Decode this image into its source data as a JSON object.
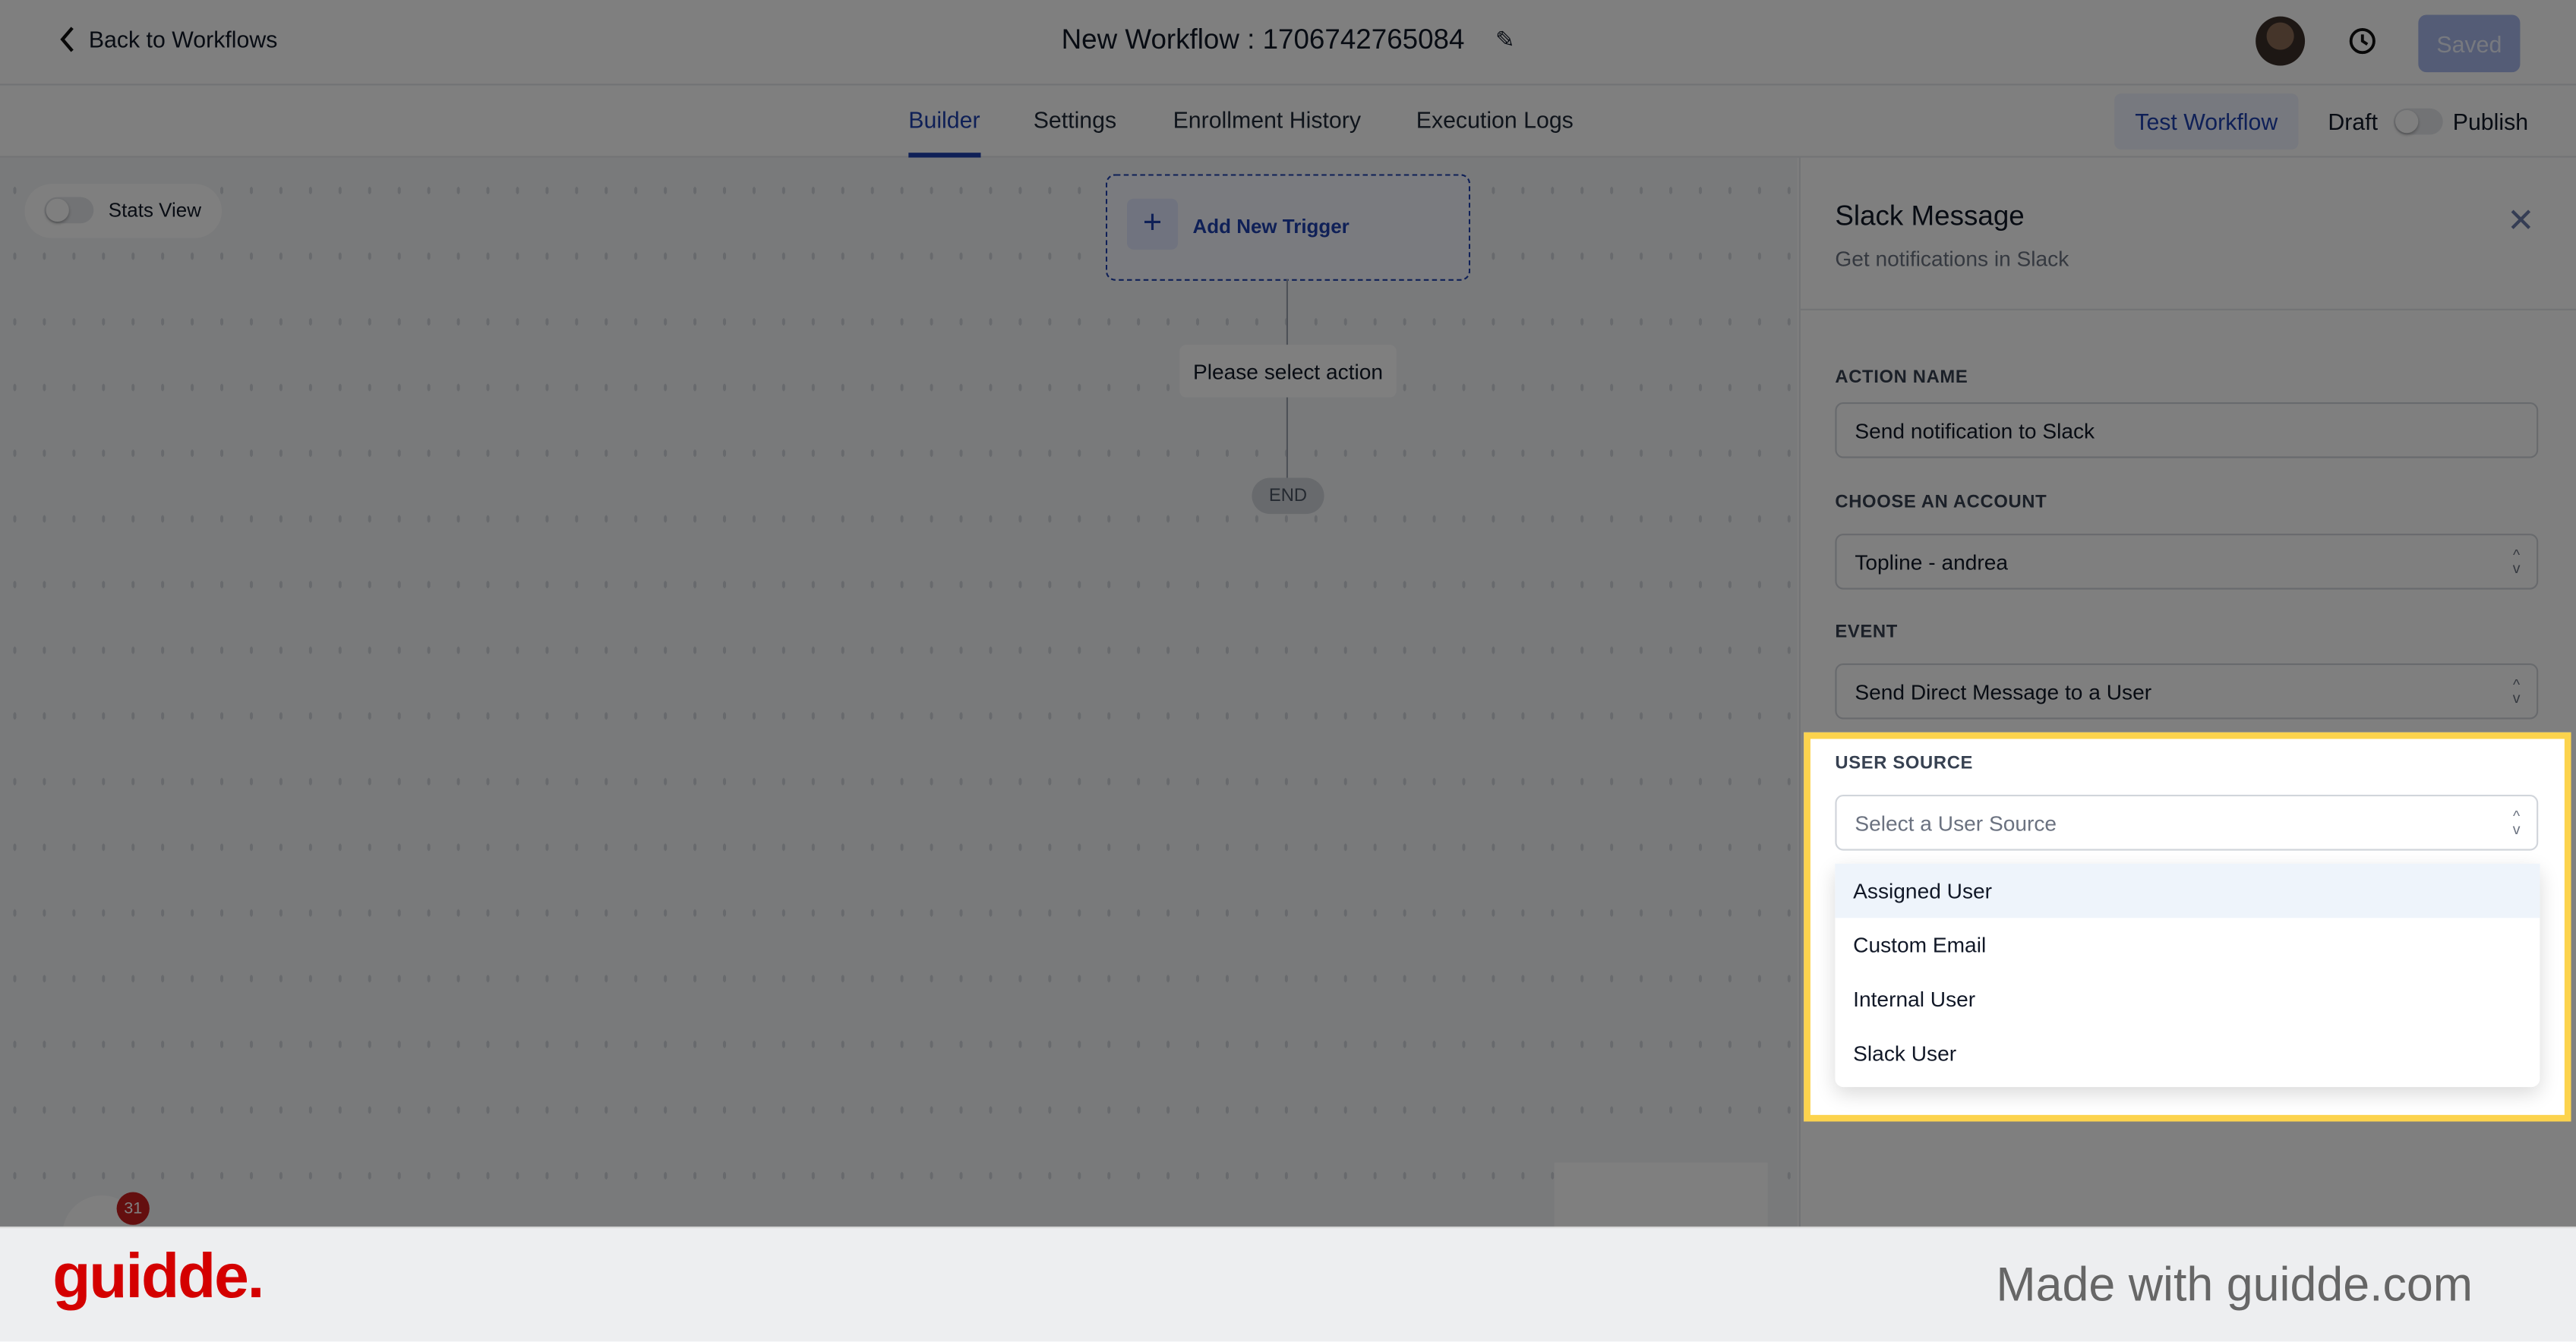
{
  "header": {
    "back_label": "Back to Workflows",
    "title": "New Workflow : 1706742765084",
    "saved_label": "Saved"
  },
  "tabs": [
    {
      "label": "Builder",
      "active": true
    },
    {
      "label": "Settings"
    },
    {
      "label": "Enrollment History"
    },
    {
      "label": "Execution Logs"
    }
  ],
  "toolbar": {
    "test_label": "Test Workflow",
    "draft_label": "Draft",
    "publish_label": "Publish",
    "publish_on": false
  },
  "canvas": {
    "stats_label": "Stats View",
    "stats_on": false,
    "trigger_label": "Add New Trigger",
    "action_label": "Please select action",
    "end_label": "END",
    "notification_count": "31"
  },
  "panel": {
    "title": "Slack Message",
    "subtitle": "Get notifications in Slack",
    "action_name_label": "ACTION NAME",
    "action_name_value": "Send notification to Slack",
    "account_label": "CHOOSE AN ACCOUNT",
    "account_value": "Topline - andrea",
    "event_label": "EVENT",
    "event_value": "Send Direct Message to a User",
    "user_source_label": "USER SOURCE",
    "user_source_placeholder": "Select a User Source",
    "user_source_options": [
      "Assigned User",
      "Custom Email",
      "Internal User",
      "Slack User"
    ]
  },
  "footer": {
    "logo": "guidde.",
    "made_with": "Made with guidde.com"
  },
  "colors": {
    "accent": "#1e40af",
    "highlight": "#fcd34d",
    "brand": "#d40000"
  }
}
